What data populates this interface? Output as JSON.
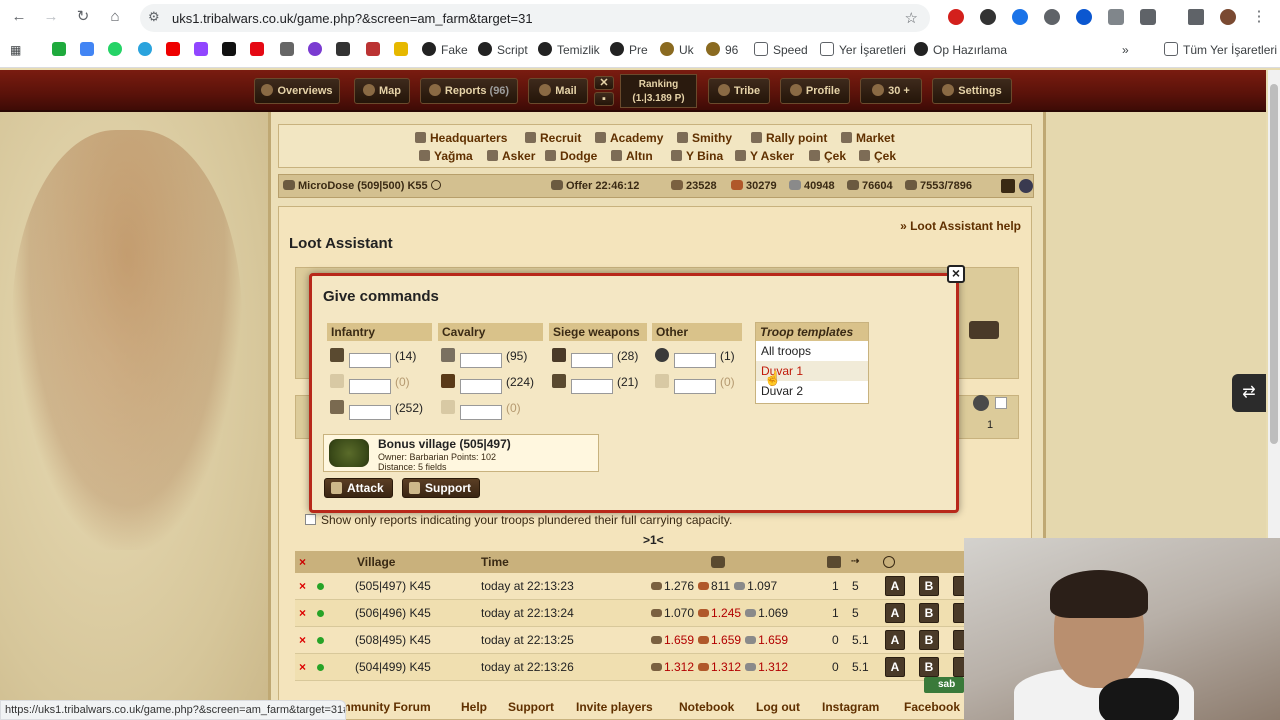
{
  "browser": {
    "url": "uks1.tribalwars.co.uk/game.php?&screen=am_farm&target=31",
    "status_url": "https://uks1.tribalwars.co.uk/game.php?&screen=am_farm&target=31#",
    "bookmarks": [
      "Fake",
      "Script",
      "Temizlik",
      "Pre",
      "Uk",
      "96",
      "Speed",
      "Yer İşaretleri",
      "Op Hazırlama"
    ],
    "all_bookmarks": "Tüm Yer İşaretleri"
  },
  "topbar": {
    "overviews": "Overviews",
    "map": "Map",
    "reports": "Reports",
    "reports_count": "(96)",
    "mail": "Mail",
    "ranking": "Ranking",
    "ranking_value": "(1.|3.189 P)",
    "tribe": "Tribe",
    "profile": "Profile",
    "premium": "30 +",
    "settings": "Settings"
  },
  "buildings": {
    "row1": [
      "Headquarters",
      "Recruit",
      "Academy",
      "Smithy",
      "Rally point",
      "Market"
    ],
    "row2": [
      "Yağma",
      "Asker",
      "Dodge",
      "Altın",
      "Y Bina",
      "Y Asker",
      "Çek",
      "Çek"
    ]
  },
  "village_bar": {
    "village": "MicroDose (509|500) K55",
    "offer": "Offer 22:46:12",
    "wood": "23528",
    "clay": "30279",
    "iron": "40948",
    "storage": "76604",
    "pop": "7553/7896"
  },
  "page": {
    "title": "Loot Assistant",
    "help": "» Loot Assistant help",
    "checkbox_label": "Show only reports indicating your troops plundered their full carrying capacity.",
    "pager": ">1<",
    "ghost_right_count": "1"
  },
  "table": {
    "headers": {
      "village": "Village",
      "time": "Time"
    },
    "rows": [
      {
        "village": "(505|497) K45",
        "time": "today at 22:13:23",
        "wood": "1.276",
        "clay": "811",
        "iron": "1.097",
        "red": false,
        "c1": "1",
        "c2": "5"
      },
      {
        "village": "(506|496) K45",
        "time": "today at 22:13:24",
        "wood": "1.070",
        "clay": "1.245",
        "iron": "1.069",
        "red": false,
        "c1": "1",
        "c2": "5"
      },
      {
        "village": "(508|495) K45",
        "time": "today at 22:13:25",
        "wood": "1.659",
        "clay": "1.659",
        "iron": "1.659",
        "red": true,
        "c1": "0",
        "c2": "5.1"
      },
      {
        "village": "(504|499) K45",
        "time": "today at 22:13:26",
        "wood": "1.312",
        "clay": "1.312",
        "iron": "1.312",
        "red": true,
        "c1": "0",
        "c2": "5.1"
      }
    ],
    "btn_a": "A",
    "btn_b": "B"
  },
  "popup": {
    "title": "Give commands",
    "categories": [
      "Infantry",
      "Cavalry",
      "Siege weapons",
      "Other"
    ],
    "infantry": [
      "(14)",
      "(0)",
      "(252)"
    ],
    "cavalry": [
      "(95)",
      "(224)",
      "(0)"
    ],
    "siege": [
      "(28)",
      "(21)"
    ],
    "other": [
      "(1)",
      "(0)"
    ],
    "templates_header": "Troop templates",
    "templates": [
      "All troops",
      "Duvar 1",
      "Duvar 2"
    ],
    "target_name": "Bonus village (505|497)",
    "target_owner": "Owner: Barbarian Points: 102",
    "target_distance": "Distance: 5 fields",
    "attack": "Attack",
    "support": "Support",
    "close": "×"
  },
  "footer": {
    "links": [
      "mmunity Forum",
      "Help",
      "Support",
      "Invite players",
      "Notebook",
      "Log out",
      "Instagram",
      "Facebook"
    ]
  },
  "chat_label": "sab",
  "colors": {
    "accent_red": "#b8281a",
    "topbar": "#5a120a",
    "brown_text": "#603000"
  }
}
